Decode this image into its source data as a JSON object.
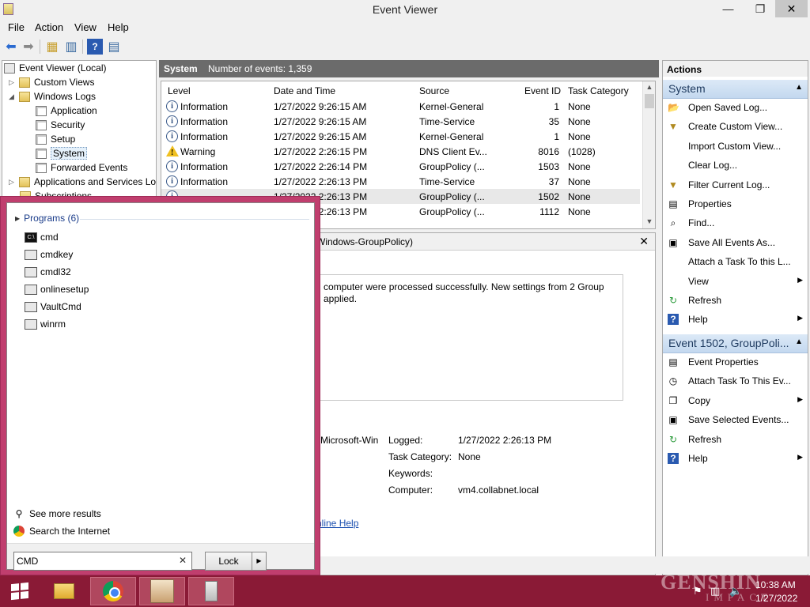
{
  "window": {
    "title": "Event Viewer",
    "min": "—",
    "max": "❐",
    "close": "✕"
  },
  "menu": [
    "File",
    "Action",
    "View",
    "Help"
  ],
  "toolbar": {
    "icons": [
      "back-arrow-icon",
      "forward-arrow-icon",
      "folder-up-icon",
      "show-hide-tree-icon",
      "help-icon",
      "properties-icon"
    ]
  },
  "tree": {
    "root": "Event Viewer (Local)",
    "custom_views": "Custom Views",
    "windows_logs": "Windows Logs",
    "logs": [
      "Application",
      "Security",
      "Setup",
      "System",
      "Forwarded Events"
    ],
    "apps_services": "Applications and Services Lo",
    "subscriptions": "Subscriptions"
  },
  "grid_header": {
    "log_name": "System",
    "count_text": "Number of events: 1,359"
  },
  "columns": [
    "Level",
    "Date and Time",
    "Source",
    "Event ID",
    "Task Category"
  ],
  "events": [
    {
      "level": "Information",
      "date": "1/27/2022 9:26:15 AM",
      "source": "Kernel-General",
      "id": "1",
      "category": "None"
    },
    {
      "level": "Information",
      "date": "1/27/2022 9:26:15 AM",
      "source": "Time-Service",
      "id": "35",
      "category": "None"
    },
    {
      "level": "Information",
      "date": "1/27/2022 9:26:15 AM",
      "source": "Kernel-General",
      "id": "1",
      "category": "None"
    },
    {
      "level": "Warning",
      "date": "1/27/2022 2:26:15 PM",
      "source": "DNS Client Ev...",
      "id": "8016",
      "category": "(1028)"
    },
    {
      "level": "Information",
      "date": "1/27/2022 2:26:14 PM",
      "source": "GroupPolicy (...",
      "id": "1503",
      "category": "None"
    },
    {
      "level": "Information",
      "date": "1/27/2022 2:26:13 PM",
      "source": "Time-Service",
      "id": "37",
      "category": "None"
    },
    {
      "level": "",
      "date": "1/27/2022 2:26:13 PM",
      "source": "GroupPolicy (...",
      "id": "1502",
      "category": "None"
    },
    {
      "level": "",
      "date": "1/27/2022 2:26:13 PM",
      "source": "GroupPolicy (...",
      "id": "1112",
      "category": "None"
    }
  ],
  "detail": {
    "title": "Windows-GroupPolicy)",
    "message": "computer were processed successfully. New settings from 2 Group applied.",
    "source_frag": "Microsoft-Win",
    "logged_label": "Logged:",
    "logged_value": "1/27/2022 2:26:13 PM",
    "task_label": "Task Category:",
    "task_value": "None",
    "keywords_label": "Keywords:",
    "computer_label": "Computer:",
    "computer_value": "vm4.collabnet.local",
    "help_link": "nline Help"
  },
  "actions": {
    "header": "Actions",
    "section1": "System",
    "items1": [
      {
        "label": "Open Saved Log...",
        "icon": "open-folder-icon",
        "glyph": "📂",
        "sub": false
      },
      {
        "label": "Create Custom View...",
        "icon": "filter-icon",
        "glyph": "▼",
        "sub": false
      },
      {
        "label": "Import Custom View...",
        "icon": "",
        "glyph": "",
        "sub": false
      },
      {
        "label": "Clear Log...",
        "icon": "",
        "glyph": "",
        "sub": false
      },
      {
        "label": "Filter Current Log...",
        "icon": "filter-icon",
        "glyph": "▼",
        "sub": false
      },
      {
        "label": "Properties",
        "icon": "properties-icon",
        "glyph": "▤",
        "sub": false
      },
      {
        "label": "Find...",
        "icon": "find-icon",
        "glyph": "⌕",
        "sub": false
      },
      {
        "label": "Save All Events As...",
        "icon": "save-icon",
        "glyph": "▣",
        "sub": false
      },
      {
        "label": "Attach a Task To this L...",
        "icon": "",
        "glyph": "",
        "sub": false
      },
      {
        "label": "View",
        "icon": "",
        "glyph": "",
        "sub": true
      },
      {
        "label": "Refresh",
        "icon": "refresh-icon",
        "glyph": "↻",
        "sub": false
      },
      {
        "label": "Help",
        "icon": "help-icon",
        "glyph": "?",
        "sub": true
      }
    ],
    "section2": "Event 1502, GroupPoli...",
    "items2": [
      {
        "label": "Event Properties",
        "icon": "properties-icon",
        "glyph": "▤",
        "sub": false
      },
      {
        "label": "Attach Task To This Ev...",
        "icon": "task-icon",
        "glyph": "◷",
        "sub": false
      },
      {
        "label": "Copy",
        "icon": "copy-icon",
        "glyph": "❐",
        "sub": true
      },
      {
        "label": "Save Selected Events...",
        "icon": "save-icon",
        "glyph": "▣",
        "sub": false
      },
      {
        "label": "Refresh",
        "icon": "refresh-icon",
        "glyph": "↻",
        "sub": false
      },
      {
        "label": "Help",
        "icon": "help-icon",
        "glyph": "?",
        "sub": true
      }
    ]
  },
  "search": {
    "programs_header": "Programs (6)",
    "programs": [
      {
        "name": "cmd",
        "icon": "cmd-icon"
      },
      {
        "name": "cmdkey",
        "icon": "console-icon"
      },
      {
        "name": "cmdl32",
        "icon": "network-icon"
      },
      {
        "name": "onlinesetup",
        "icon": "setup-icon"
      },
      {
        "name": "VaultCmd",
        "icon": "console-icon"
      },
      {
        "name": "winrm",
        "icon": "setup-icon"
      }
    ],
    "see_more": "See more results",
    "search_internet": "Search the Internet",
    "query": "CMD",
    "lock_label": "Lock"
  },
  "taskbar": {
    "clock_time": "10:38 AM",
    "clock_date": "1/27/2022",
    "watermark1": "GENSHIN",
    "watermark2": "IMPACT"
  }
}
